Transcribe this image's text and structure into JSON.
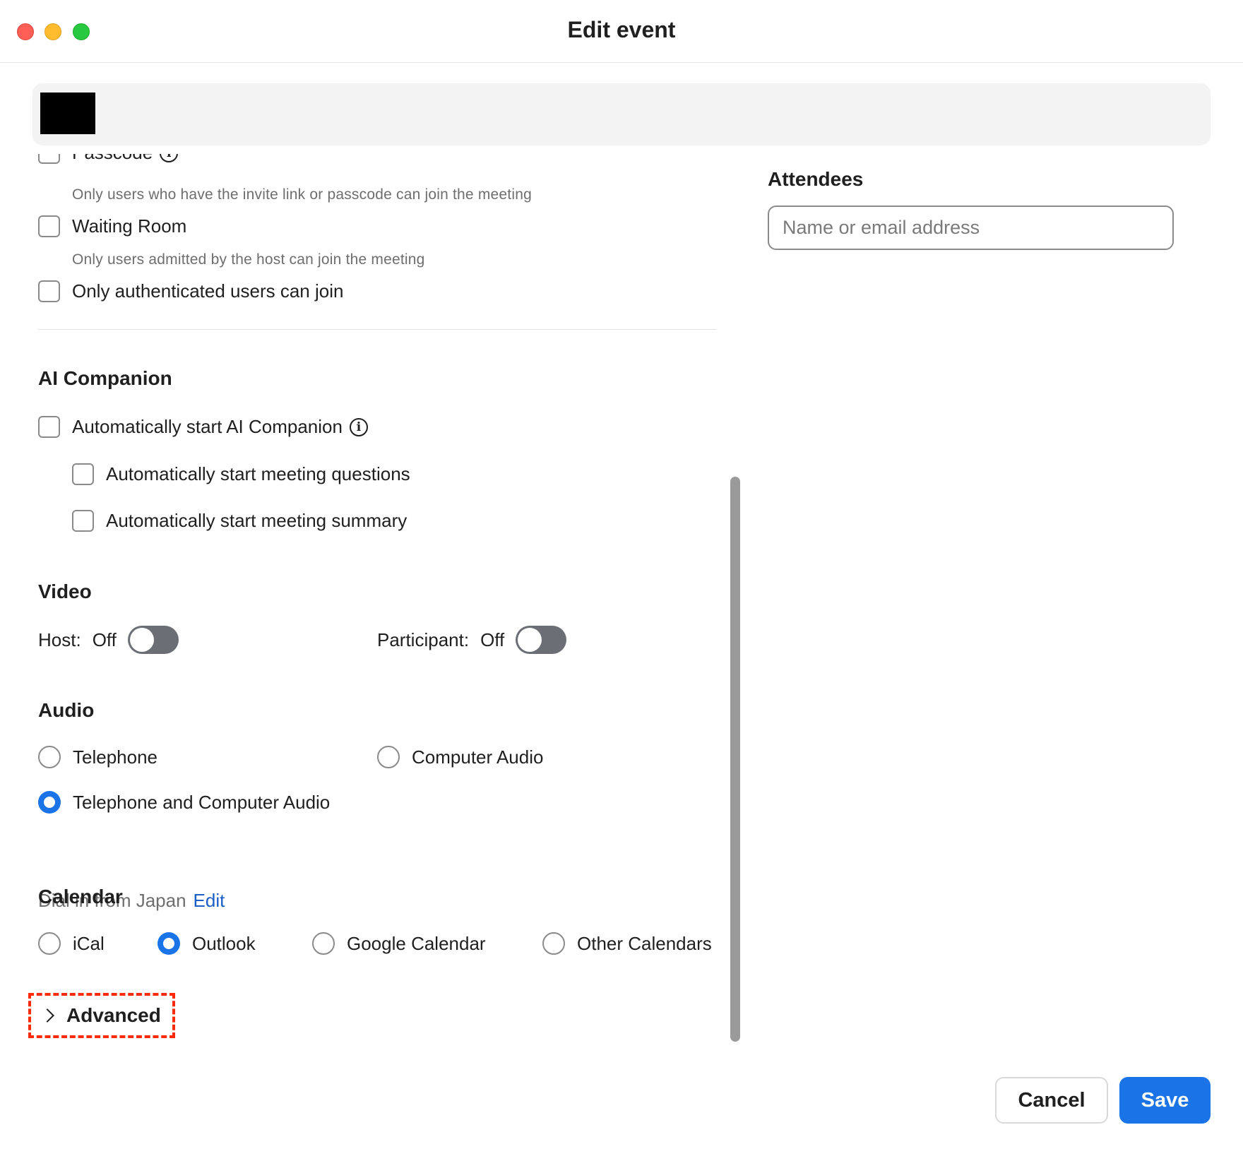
{
  "window": {
    "title": "Edit event"
  },
  "security": {
    "passcode_label": "Passcode",
    "passcode_help": "Only users who have the invite link or passcode can join the meeting",
    "waiting_room_label": "Waiting Room",
    "waiting_room_help": "Only users admitted by the host can join the meeting",
    "authenticated_label": "Only authenticated users can join"
  },
  "ai_companion": {
    "title": "AI Companion",
    "auto_start_label": "Automatically start AI Companion",
    "questions_label": "Automatically start meeting questions",
    "summary_label": "Automatically start meeting summary"
  },
  "video": {
    "title": "Video",
    "host_label": "Host:",
    "host_value": "Off",
    "participant_label": "Participant:",
    "participant_value": "Off"
  },
  "audio": {
    "title": "Audio",
    "options": [
      "Telephone",
      "Computer Audio",
      "Telephone and Computer Audio"
    ],
    "selected": "Telephone and Computer Audio",
    "dial_in_text": "Dial in from Japan",
    "edit_link": "Edit"
  },
  "calendar": {
    "title": "Calendar",
    "options": [
      "iCal",
      "Outlook",
      "Google Calendar",
      "Other Calendars"
    ],
    "selected": "Outlook"
  },
  "advanced": {
    "label": "Advanced"
  },
  "attendees": {
    "title": "Attendees",
    "placeholder": "Name or email address"
  },
  "footer": {
    "cancel_label": "Cancel",
    "save_label": "Save"
  },
  "colors": {
    "accent": "#1a74e8",
    "highlight": "#ff2a0a",
    "toggle_off": "#6b6e74"
  }
}
